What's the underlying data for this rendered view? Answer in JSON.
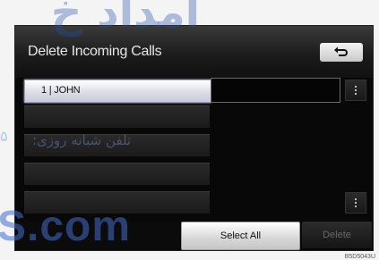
{
  "header": {
    "title": "Delete Incoming Calls",
    "back_icon": "return-arrow-icon"
  },
  "calls": [
    {
      "label": "1 | JOHN",
      "selected": true
    },
    {
      "label": "",
      "selected": false
    },
    {
      "label": "",
      "selected": false
    },
    {
      "label": "",
      "selected": false
    },
    {
      "label": "",
      "selected": false
    }
  ],
  "footer": {
    "select_all_label": "Select All",
    "delete_label": "Delete"
  },
  "scroll": {
    "up_icon": "scroll-up-icon",
    "down_icon": "scroll-down-icon"
  },
  "watermarks": {
    "top": "امداد خ",
    "rtl": "تلفن شبانه روزی:",
    "rtl_edge": "۵",
    "bottom": "S.com"
  },
  "image_code": "B5D5043U",
  "colors": {
    "screen_bg": "#080808",
    "highlight": "#dcdde6",
    "disabled_text": "#676767"
  }
}
